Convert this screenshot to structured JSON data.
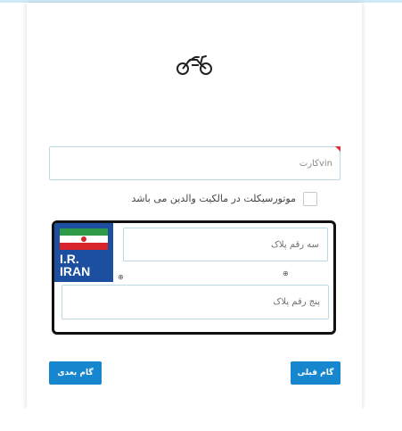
{
  "vin": {
    "placeholder": "vinکارت",
    "value": ""
  },
  "parent_ownership": {
    "label": "موتورسیکلت در مالکیت والدین می باشد",
    "checked": false
  },
  "plate": {
    "country_text": "I.R.\nIRAN",
    "three_digit": {
      "placeholder": "سه رقم پلاک",
      "value": ""
    },
    "five_digit": {
      "placeholder": "پنج رقم پلاک",
      "value": ""
    },
    "marks": [
      "⊕",
      "⊕"
    ]
  },
  "buttons": {
    "next_label": "گام بعدی",
    "prev_label": "گام قبلی"
  },
  "colors": {
    "accent": "#1687cf",
    "plate_blue": "#1d4fa0",
    "field_border": "#bcd9e6",
    "required_marker": "#e0303a"
  },
  "icons": {
    "header": "motorcycle-icon",
    "flag": "iran-flag-icon"
  }
}
